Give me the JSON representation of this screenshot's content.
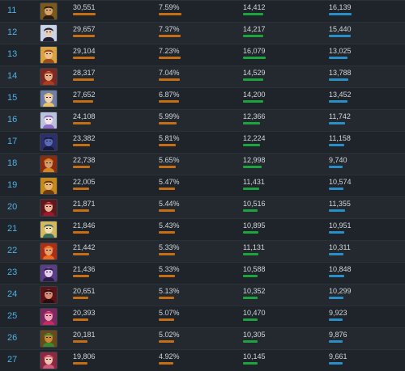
{
  "colors": {
    "games_bar": "#c56e14",
    "pct_bar": "#c56e14",
    "wins_bar": "#1da53d",
    "losses_bar": "#2a8fc7",
    "rank_text": "#4fb1e6"
  },
  "rows": [
    {
      "rank": "11",
      "games": "30,551",
      "pct": "7.59%",
      "wins": "14,412",
      "losses": "16,139",
      "portrait": {
        "bg": "#7a5a1c",
        "skin": "#d7a36a",
        "hair": "#2a1a10"
      }
    },
    {
      "rank": "12",
      "games": "29,657",
      "pct": "7.37%",
      "wins": "14,217",
      "losses": "15,440",
      "portrait": {
        "bg": "#c9d4e6",
        "skin": "#e9cdb3",
        "hair": "#1e1f35"
      }
    },
    {
      "rank": "13",
      "games": "29,104",
      "pct": "7.23%",
      "wins": "16,079",
      "losses": "13,025",
      "portrait": {
        "bg": "#d8a444",
        "skin": "#f0c08a",
        "hair": "#9c4c1a"
      }
    },
    {
      "rank": "14",
      "games": "28,317",
      "pct": "7.04%",
      "wins": "14,529",
      "losses": "13,788",
      "portrait": {
        "bg": "#7a2a24",
        "skin": "#e4b08a",
        "hair": "#b23a1e"
      }
    },
    {
      "rank": "15",
      "games": "27,652",
      "pct": "6.87%",
      "wins": "14,200",
      "losses": "13,452",
      "portrait": {
        "bg": "#6f7fa8",
        "skin": "#f0d2b8",
        "hair": "#e7c46a"
      }
    },
    {
      "rank": "16",
      "games": "24,108",
      "pct": "5.99%",
      "wins": "12,366",
      "losses": "11,742",
      "portrait": {
        "bg": "#b9c4dc",
        "skin": "#f2e4ea",
        "hair": "#8e6cc6"
      }
    },
    {
      "rank": "17",
      "games": "23,382",
      "pct": "5.81%",
      "wins": "12,224",
      "losses": "11,158",
      "portrait": {
        "bg": "#2c2f6c",
        "skin": "#5c6bb5",
        "hair": "#151a3a"
      }
    },
    {
      "rank": "18",
      "games": "22,738",
      "pct": "5.65%",
      "wins": "12,998",
      "losses": "9,740",
      "portrait": {
        "bg": "#8a2b12",
        "skin": "#d79a6b",
        "hair": "#d38620"
      }
    },
    {
      "rank": "19",
      "games": "22,005",
      "pct": "5.47%",
      "wins": "11,431",
      "losses": "10,574",
      "portrait": {
        "bg": "#c58a1e",
        "skin": "#e9b577",
        "hair": "#6b3a10"
      }
    },
    {
      "rank": "20",
      "games": "21,871",
      "pct": "5.44%",
      "wins": "10,516",
      "losses": "11,355",
      "portrait": {
        "bg": "#5a1a1e",
        "skin": "#e7b59a",
        "hair": "#a0172a"
      }
    },
    {
      "rank": "21",
      "games": "21,846",
      "pct": "5.43%",
      "wins": "10,895",
      "losses": "10,951",
      "portrait": {
        "bg": "#d3ba62",
        "skin": "#f1dcb0",
        "hair": "#3a6c5a"
      }
    },
    {
      "rank": "22",
      "games": "21,442",
      "pct": "5.33%",
      "wins": "11,131",
      "losses": "10,311",
      "portrait": {
        "bg": "#a8301a",
        "skin": "#e6a06a",
        "hair": "#f06b1f"
      }
    },
    {
      "rank": "23",
      "games": "21,436",
      "pct": "5.33%",
      "wins": "10,588",
      "losses": "10,848",
      "portrait": {
        "bg": "#5b3f86",
        "skin": "#e8cfee",
        "hair": "#2b1a4a"
      }
    },
    {
      "rank": "24",
      "games": "20,651",
      "pct": "5.13%",
      "wins": "10,352",
      "losses": "10,299",
      "portrait": {
        "bg": "#5a1418",
        "skin": "#d58d78",
        "hair": "#2a0c10"
      }
    },
    {
      "rank": "25",
      "games": "20,393",
      "pct": "5.07%",
      "wins": "10,470",
      "losses": "9,923",
      "portrait": {
        "bg": "#7a2a62",
        "skin": "#f0a6b8",
        "hair": "#c42b64"
      }
    },
    {
      "rank": "26",
      "games": "20,181",
      "pct": "5.02%",
      "wins": "10,305",
      "losses": "9,876",
      "portrait": {
        "bg": "#6a4a1a",
        "skin": "#c88a3a",
        "hair": "#3a8a2a"
      }
    },
    {
      "rank": "27",
      "games": "19,806",
      "pct": "4.92%",
      "wins": "10,145",
      "losses": "9,661",
      "portrait": {
        "bg": "#8a2a40",
        "skin": "#f0c0b0",
        "hair": "#d05a78"
      }
    }
  ]
}
